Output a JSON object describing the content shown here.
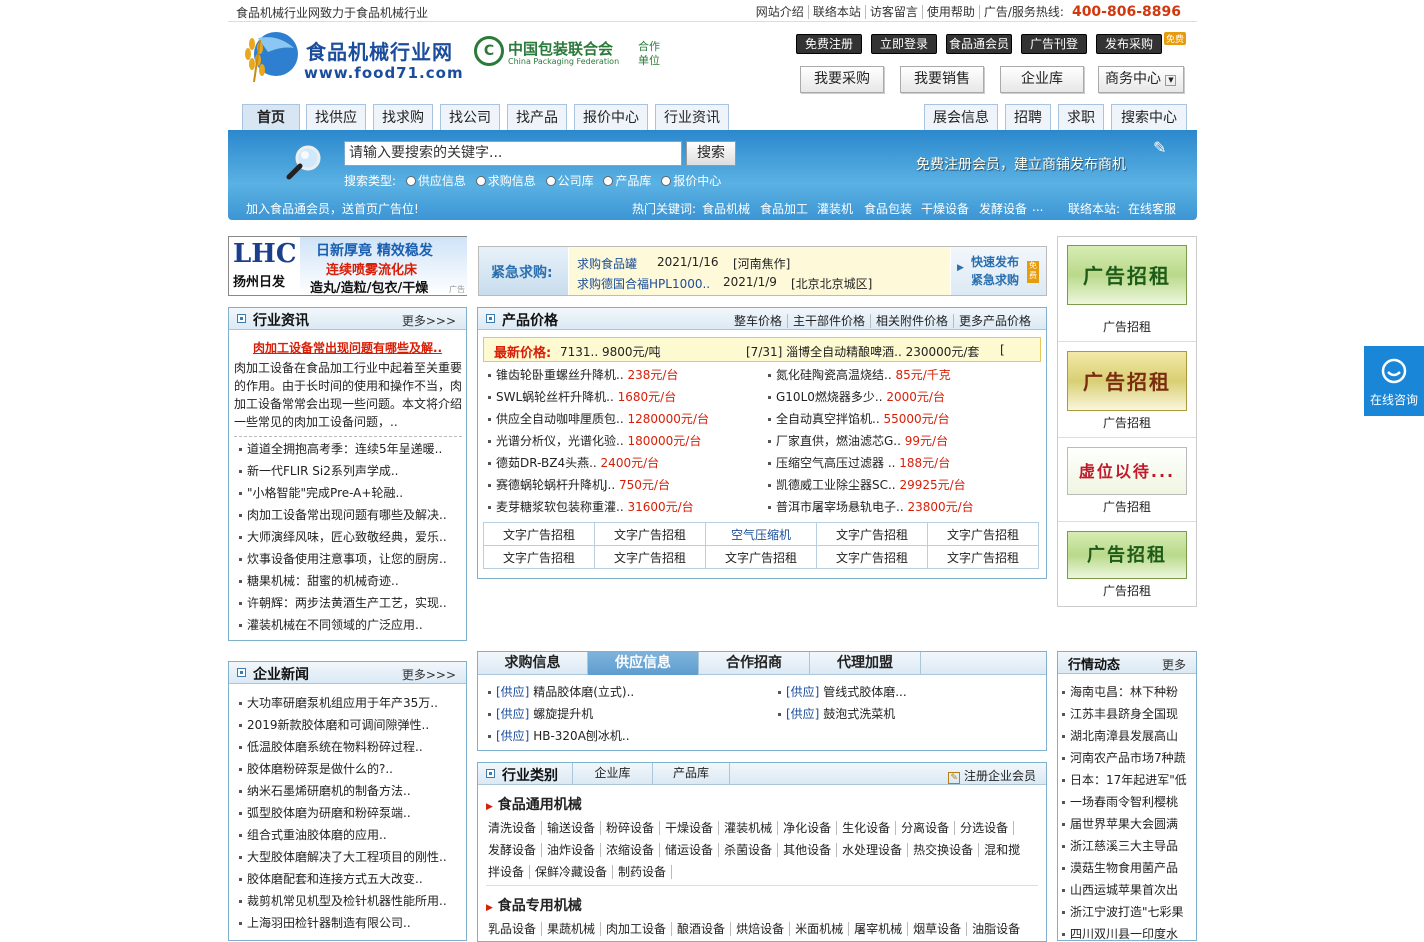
{
  "topbar": {
    "slogan": "食品机械行业网致力于食品机械行业",
    "links": [
      "网站介绍",
      "联络本站",
      "访客留言",
      "使用帮助",
      "广告/服务热线:"
    ],
    "hotline": "400-806-8896"
  },
  "logo": {
    "cn": "食品机械行业网",
    "url": "www.food71.com"
  },
  "partner": {
    "cn": "中国包装联合会",
    "en": "China Packaging Federation",
    "label": "合作单位",
    "mark": "C"
  },
  "account_buttons": [
    "免费注册",
    "立即登录",
    "食品通会员",
    "广告刊登",
    "发布采购"
  ],
  "free_badge": "免费",
  "gray_buttons": [
    "我要采购",
    "我要销售",
    "企业库",
    "商务中心"
  ],
  "nav_left": [
    "首页",
    "找供应",
    "找求购",
    "找公司",
    "找产品",
    "报价中心",
    "行业资讯"
  ],
  "nav_right": [
    "展会信息",
    "招聘",
    "求职",
    "搜索中心"
  ],
  "search": {
    "placeholder": "请输入要搜索的关键字...",
    "button": "搜索",
    "type_label": "搜索类型:",
    "types": [
      "供应信息",
      "求购信息",
      "公司库",
      "产品库",
      "报价中心"
    ],
    "promo": "免费注册会员，建立商铺发布商机"
  },
  "search_bottom": {
    "left": "加入食品通会员，送首页广告位!",
    "hot_label": "热门关键词:",
    "hot": [
      "食品机械",
      "食品加工",
      "灌装机",
      "食品包装",
      "干燥设备",
      "发酵设备"
    ],
    "ellipsis": "...",
    "contact": "联络本站:",
    "online": "在线客服"
  },
  "left_ad": {
    "brand": "LHC",
    "brand_sub": "扬州日发",
    "line1": "日新厚竟 精效稳发",
    "line2": "连续喷雾流化床",
    "line3": "造丸/造粒/包衣/干燥",
    "tag": "广告"
  },
  "urgent": {
    "label": "紧急求购:",
    "rows": [
      {
        "item": "求购食品罐",
        "date": "2021/1/16",
        "place": "[河南焦作]"
      },
      {
        "item": "求购德国合福HPL1000..",
        "date": "2021/1/9",
        "place": "[北京北京城区]"
      }
    ],
    "cta1": "快速发布",
    "cta2": "紧急求购",
    "badge": "免费"
  },
  "industry_news": {
    "title": "行业资讯",
    "more": "更多>>>",
    "headline": "肉加工设备常出现问题有哪些及解..",
    "summary": "肉加工设备在食品加工行业中起着至关重要的作用。由于长时间的使用和操作不当，肉加工设备常常会出现一些问题。本文将介绍一些常见的肉加工设备问题，..",
    "items": [
      "道道全拥抱高考季：连续5年呈递暖..",
      "新一代FLIR Si2系列声学成..",
      "\"小格智能\"完成Pre-A+轮融..",
      "肉加工设备常出现问题有哪些及解决..",
      "大师演绎风味，匠心致敬经典，爱乐..",
      "炊事设备使用注意事项，让您的厨房..",
      "糖果机械：甜蜜的机械奇迹..",
      "许朝辉：两步法黄酒生产工艺，实现..",
      "灌装机械在不同领域的广泛应用.."
    ]
  },
  "prices": {
    "title": "产品价格",
    "links": [
      "整车价格",
      "主干部件价格",
      "相关附件价格",
      "更多产品价格"
    ],
    "latest_label": "最新价格:",
    "latest_1": "7131.. 9800元/吨",
    "latest_2": "[7/31] 淄博全自动精酿啤酒.. 230000元/套",
    "latest_3": "[",
    "left": [
      {
        "n": "锥齿轮卧重螺丝升降机..",
        "p": "238元/台"
      },
      {
        "n": "SWL蜗轮丝杆升降机..",
        "p": "1680元/台"
      },
      {
        "n": "供应全自动咖啡厘质包..",
        "p": "1280000元/台"
      },
      {
        "n": "光谱分析仪，光谱化验..",
        "p": "180000元/台"
      },
      {
        "n": "德茹DR-BZ4头燕..",
        "p": "2400元/台"
      },
      {
        "n": "赛德蜗轮蜗杆升降机J..",
        "p": "750元/台"
      },
      {
        "n": "麦芽糖浆软包装称重灌..",
        "p": "31600元/台"
      }
    ],
    "right": [
      {
        "n": "氮化硅陶瓷高温烧结..",
        "p": "85元/千克"
      },
      {
        "n": "G10L0燃烧器多少..",
        "p": "2000元/台"
      },
      {
        "n": "全自动真空拌馅机..",
        "p": "55000元/台"
      },
      {
        "n": "厂家直供，燃油滤芯G..",
        "p": "99元/台"
      },
      {
        "n": "压缩空气高压过滤器 ..",
        "p": "188元/台"
      },
      {
        "n": "凯德威工业除尘器SC..",
        "p": "29925元/台"
      },
      {
        "n": "普洱市屠宰场悬轨电子..",
        "p": "23800元/台"
      }
    ],
    "textads": [
      [
        "文字广告招租",
        "文字广告招租",
        "空气压缩机",
        "文字广告招租",
        "文字广告招租"
      ],
      [
        "文字广告招租",
        "文字广告招租",
        "文字广告招租",
        "文字广告招租",
        "文字广告招租"
      ]
    ]
  },
  "right_ads": {
    "labels": [
      "广告招租",
      "广告招租",
      "广告招租",
      "广告招租"
    ],
    "tiles": [
      "广告招租",
      "广告招租",
      "虚位以待...",
      "广告招租"
    ]
  },
  "company_news": {
    "title": "企业新闻",
    "more": "更多>>>",
    "items": [
      "大功率研磨泵机组应用于年产35万..",
      "2019新款胶体磨和可调间隙弹性..",
      "低温胶体磨系统在物料粉碎过程..",
      "胶体磨粉碎泵是做什么的?..",
      "纳米石墨烯研磨机的制备方法..",
      "弧型胶体磨为研磨和粉碎泵端..",
      "组合式重油胶体磨的应用..",
      "大型胶体磨解决了大工程项目的刚性..",
      "胶体磨配套和连接方式五大改变..",
      "裁剪机常见机型及检针机器性能所用..",
      "上海羽田检针器制造有限公司.."
    ]
  },
  "supply_tabs": {
    "tabs": [
      "求购信息",
      "供应信息",
      "合作招商",
      "代理加盟"
    ],
    "prefix": "[供应]",
    "items": [
      "精品胶体磨(立式)..",
      "管线式胶体磨...",
      "螺旋提升机",
      "鼓泡式洗菜机",
      "HB-320A刨冰机.."
    ]
  },
  "categories": {
    "title": "行业类别",
    "tabs": [
      "企业库",
      "产品库"
    ],
    "register": "注册企业会员",
    "group1": "食品通用机械",
    "links1a": [
      "清洗设备",
      "输送设备",
      "粉碎设备",
      "干燥设备",
      "灌装机械",
      "净化设备",
      "生化设备",
      "分离设备",
      "分选设备"
    ],
    "links1b": [
      "发酵设备",
      "油炸设备",
      "浓缩设备",
      "储运设备",
      "杀菌设备",
      "其他设备",
      "水处理设备",
      "热交换设备",
      "混和搅"
    ],
    "links1c": [
      "拌设备",
      "保鲜冷藏设备",
      "制药设备"
    ],
    "group2": "食品专用机械",
    "links2": [
      "乳品设备",
      "果蔬机械",
      "肉加工设备",
      "酿酒设备",
      "烘焙设备",
      "米面机械",
      "屠宰机械",
      "烟草设备",
      "油脂设备"
    ]
  },
  "market": {
    "title": "行情动态",
    "more": "更多",
    "items": [
      "海南屯昌：林下种粉",
      "江苏丰县跻身全国现",
      "湖北南漳县发展高山",
      "河南农产品市场7种蔬",
      "日本：17年起进军\"低",
      "一场春雨令智利樱桃",
      "届世界苹果大会圆满",
      "浙江慈溪三大主导品",
      "漠菇生物食用菌产品",
      "山西运城苹果首次出",
      "浙江宁波打造\"七彩果",
      "四川双川县一印度水"
    ]
  },
  "float": {
    "label": "在线咨询"
  },
  "colors": {
    "accent": "#2b88cc",
    "hotline": "#d2380e",
    "price_red": "#d81e06",
    "link_blue": "#1b4d9c"
  }
}
